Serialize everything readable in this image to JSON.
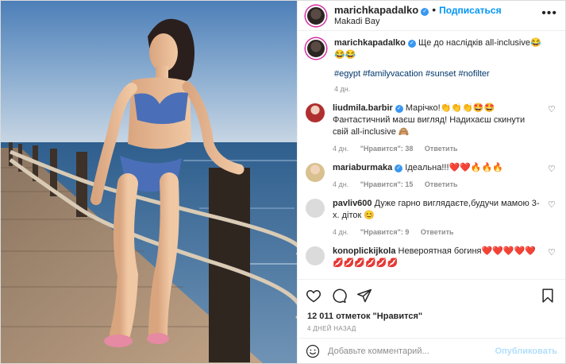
{
  "header": {
    "username": "marichkapadalko",
    "dot": "•",
    "follow_label": "Подписаться",
    "location": "Makadi Bay",
    "more": "•••"
  },
  "caption": {
    "username": "marichkapadalko",
    "text": "Ще до наслідків all-inclusive😂😂😂",
    "tags": "#egypt #familyvacation #sunset #nofilter",
    "time": "4 дн."
  },
  "comments": [
    {
      "username": "liudmila.barbir",
      "text": "Марічко!👏👏👏🤩🤩 Фантастичний маєш вигляд! Надихаєш скинути свій all-inclusive 🙈",
      "time": "4 дн.",
      "likes": "\"Нравится\": 38",
      "reply": "Ответить"
    },
    {
      "username": "mariaburmaka",
      "text": "Ідеальна!!!❤️❤️🔥🔥🔥",
      "time": "4 дн.",
      "likes": "\"Нравится\": 15",
      "reply": "Ответить"
    },
    {
      "username": "pavliv600",
      "text": "Дуже гарно виглядаєте,будучи мамою 3-х. діток 😊",
      "time": "4 дн.",
      "likes": "\"Нравится\": 9",
      "reply": "Ответить"
    },
    {
      "username": "konoplickijkola",
      "text": "Невероятная богиня❤️❤️❤️❤️❤️💋💋💋💋💋💋",
      "time": "",
      "likes": "",
      "reply": ""
    }
  ],
  "likes_count": "12 011 отметок \"Нравится\"",
  "post_date": "4 ДНЕЙ НАЗАД",
  "add_comment": {
    "placeholder": "Добавьте комментарий...",
    "publish_label": "Опубликовать"
  },
  "colors": {
    "link_blue": "#0095f6",
    "tag_blue": "#00376b",
    "muted": "#8e8e8e",
    "publish_disabled": "#b2dffc"
  }
}
